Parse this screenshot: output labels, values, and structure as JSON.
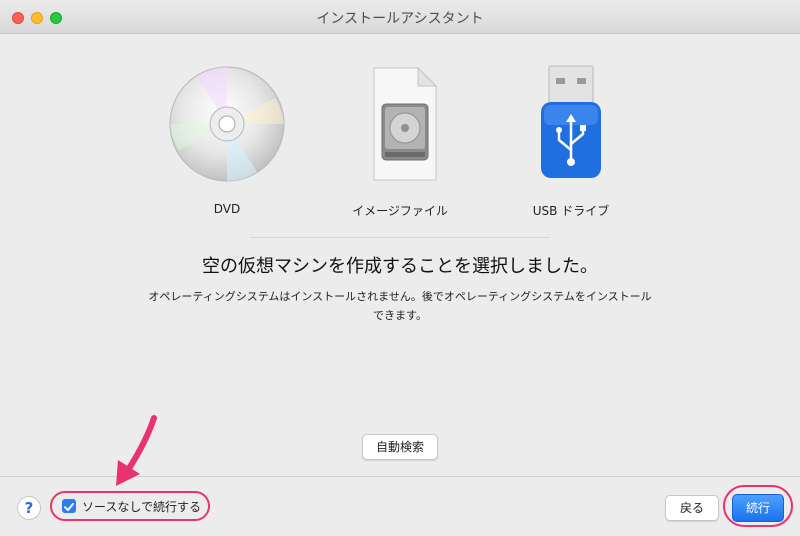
{
  "window": {
    "title": "インストールアシスタント"
  },
  "sources": [
    {
      "label": "DVD",
      "icon": "dvd-disc-icon"
    },
    {
      "label": "イメージファイル",
      "icon": "disk-image-file-icon"
    },
    {
      "label": "USB ドライブ",
      "icon": "usb-drive-icon"
    }
  ],
  "message": {
    "heading": "空の仮想マシンを作成することを選択しました。",
    "line1": "オペレーティングシステムはインストールされません。後でオペレーティングシステムをインストール",
    "line2": "できます。"
  },
  "buttons": {
    "auto_detect": "自動検索",
    "help": "?",
    "back": "戻る",
    "continue": "続行"
  },
  "checkbox": {
    "label": "ソースなしで続行する",
    "checked": true
  },
  "colors": {
    "accent": "#2a7cf0",
    "highlight": "#e8336f"
  }
}
